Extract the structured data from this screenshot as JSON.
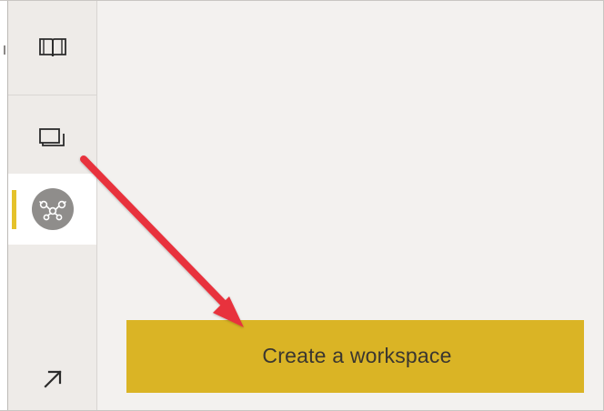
{
  "nav_rail": {
    "items": [
      {
        "icon": "book-icon",
        "label": ""
      },
      {
        "icon": "workspaces-icon",
        "label": ""
      },
      {
        "icon": "deployment-pipelines-icon",
        "label": "",
        "selected": true
      },
      {
        "icon": "expand-arrow-icon",
        "label": ""
      }
    ]
  },
  "main": {
    "create_workspace_label": "Create a workspace"
  },
  "colors": {
    "accent": "#dab425",
    "selected_indicator": "#e5c22b",
    "annotation_arrow": "#e8323c",
    "background": "#f3f1ef"
  }
}
